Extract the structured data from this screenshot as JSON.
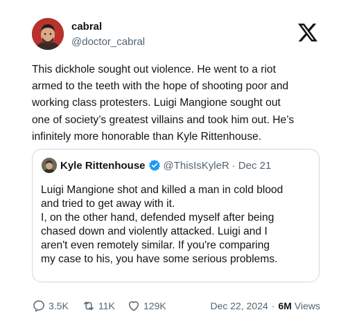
{
  "author": {
    "name": "cabral",
    "handle": "@doctor_cabral",
    "avatar_icon": "profile-photo-icon"
  },
  "logo_icon": "x-logo-icon",
  "post_text": "This dickhole sought out violence. He went to a riot\narmed to the teeth with the hope of shooting poor and\nworking class protesters. Luigi Mangione sought out\none of society’s greatest villains and took him out. He’s\ninfinitely more honorable than Kyle Rittenhouse.",
  "quoted": {
    "name": "Kyle Rittenhouse",
    "handle": "@ThisIsKyleR",
    "separator": "·",
    "date": "Dec 21",
    "verified_color": "#1d9bf0",
    "text": "Luigi Mangione shot and killed a man in cold blood\nand tried to get away with it.\nI, on the other hand, defended myself after being\nchased down and violently attacked. Luigi and I\naren't even remotely similar. If you're comparing\nmy case to his, you have some serious problems."
  },
  "stats": {
    "replies": "3.5K",
    "reposts": "11K",
    "likes": "129K",
    "date": "Dec 22, 2024",
    "separator": "·",
    "views_count": "6M",
    "views_label": "Views"
  }
}
